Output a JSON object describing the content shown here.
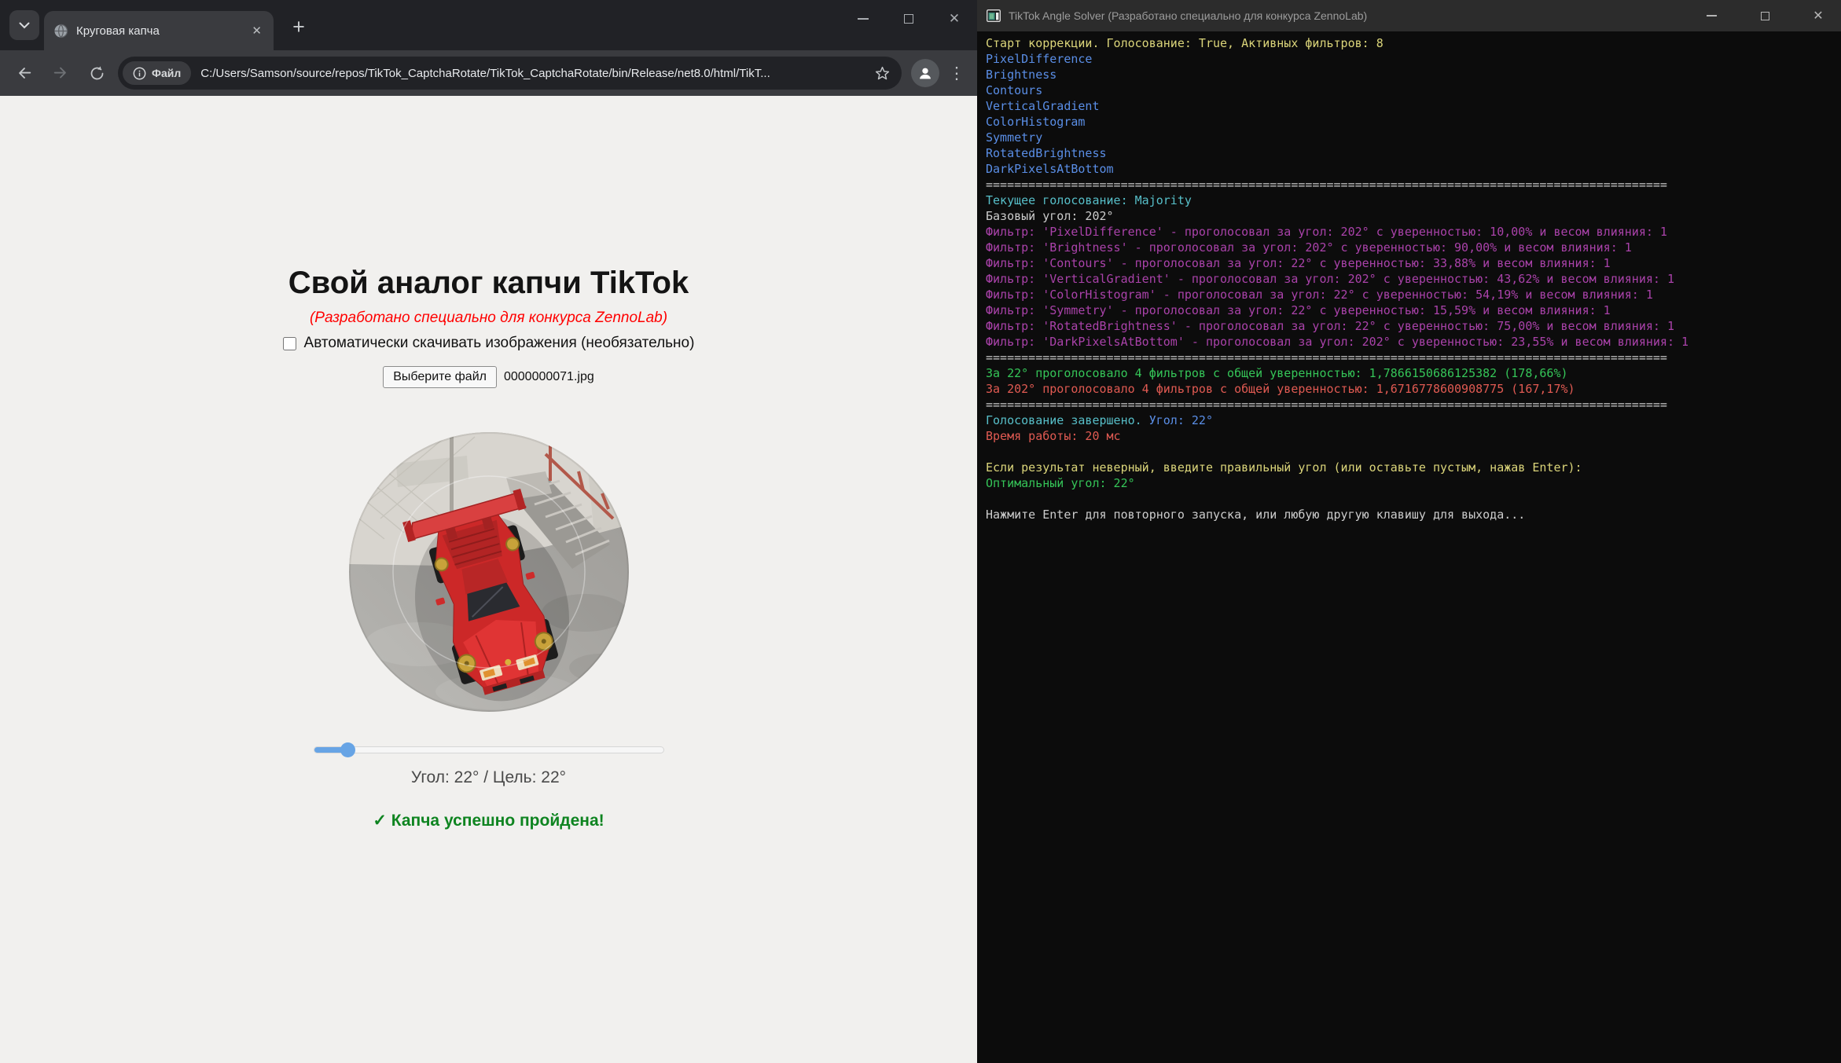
{
  "icons": {
    "close_glyph": "✕",
    "plus_glyph": "+",
    "menu_glyph": "⋮"
  },
  "browser": {
    "tab": {
      "title": "Круговая капча"
    },
    "nav": {
      "file_chip_label": "Файл",
      "url": "C:/Users/Samson/source/repos/TikTok_CaptchaRotate/TikTok_CaptchaRotate/bin/Release/net8.0/html/TikT..."
    },
    "page": {
      "title": "Свой аналог капчи TikTok",
      "subtitle": "(Разработано специально для конкурса ZennoLab)",
      "checkbox_label": "Автоматически скачивать изображения (необязательно)",
      "checkbox_checked": false,
      "file_button_label": "Выберите файл",
      "file_name": "0000000071.jpg",
      "slider_percent": 9.6,
      "angle_label": "Угол: 22° / Цель: 22°",
      "success_message": "✓ Капча успешно пройдена!"
    }
  },
  "console": {
    "title": "TikTok Angle Solver (Разработано специально для конкурса ZennoLab)",
    "colors": {
      "yellow": "#DBD57A",
      "blue": "#5A8EE6",
      "cyan": "#57BFC9",
      "magenta": "#AA42AA",
      "green": "#35C558",
      "red": "#E05A52",
      "white": "#CCCCCC"
    },
    "lines": [
      {
        "segments": [
          {
            "c": "yellow",
            "t": "Старт коррекции. Голосование: True, Активных фильтров: 8"
          }
        ]
      },
      {
        "segments": [
          {
            "c": "blue",
            "t": "PixelDifference"
          }
        ]
      },
      {
        "segments": [
          {
            "c": "blue",
            "t": "Brightness"
          }
        ]
      },
      {
        "segments": [
          {
            "c": "blue",
            "t": "Contours"
          }
        ]
      },
      {
        "segments": [
          {
            "c": "blue",
            "t": "VerticalGradient"
          }
        ]
      },
      {
        "segments": [
          {
            "c": "blue",
            "t": "ColorHistogram"
          }
        ]
      },
      {
        "segments": [
          {
            "c": "blue",
            "t": "Symmetry"
          }
        ]
      },
      {
        "segments": [
          {
            "c": "blue",
            "t": "RotatedBrightness"
          }
        ]
      },
      {
        "segments": [
          {
            "c": "blue",
            "t": "DarkPixelsAtBottom"
          }
        ]
      },
      {
        "segments": [
          {
            "c": "white",
            "t": "================================================================================================"
          }
        ]
      },
      {
        "segments": [
          {
            "c": "cyan",
            "t": "Текущее голосование: Majority"
          }
        ]
      },
      {
        "segments": [
          {
            "c": "white",
            "t": "Базовый угол: 202°"
          }
        ]
      },
      {
        "segments": [
          {
            "c": "magenta",
            "t": "Фильтр: 'PixelDifference' - проголосовал за угол: 202° с уверенностью: 10,00% и весом влияния: 1"
          }
        ]
      },
      {
        "segments": [
          {
            "c": "magenta",
            "t": "Фильтр: 'Brightness' - проголосовал за угол: 202° с уверенностью: 90,00% и весом влияния: 1"
          }
        ]
      },
      {
        "segments": [
          {
            "c": "magenta",
            "t": "Фильтр: 'Contours' - проголосовал за угол: 22° с уверенностью: 33,88% и весом влияния: 1"
          }
        ]
      },
      {
        "segments": [
          {
            "c": "magenta",
            "t": "Фильтр: 'VerticalGradient' - проголосовал за угол: 202° с уверенностью: 43,62% и весом влияния: 1"
          }
        ]
      },
      {
        "segments": [
          {
            "c": "magenta",
            "t": "Фильтр: 'ColorHistogram' - проголосовал за угол: 22° с уверенностью: 54,19% и весом влияния: 1"
          }
        ]
      },
      {
        "segments": [
          {
            "c": "magenta",
            "t": "Фильтр: 'Symmetry' - проголосовал за угол: 22° с уверенностью: 15,59% и весом влияния: 1"
          }
        ]
      },
      {
        "segments": [
          {
            "c": "magenta",
            "t": "Фильтр: 'RotatedBrightness' - проголосовал за угол: 22° с уверенностью: 75,00% и весом влияния: 1"
          }
        ]
      },
      {
        "segments": [
          {
            "c": "magenta",
            "t": "Фильтр: 'DarkPixelsAtBottom' - проголосовал за угол: 202° с уверенностью: 23,55% и весом влияния: 1"
          }
        ]
      },
      {
        "segments": [
          {
            "c": "white",
            "t": "================================================================================================"
          }
        ]
      },
      {
        "segments": [
          {
            "c": "green",
            "t": "За 22° проголосовало 4 фильтров с общей уверенностью: 1,7866150686125382 (178,66%)"
          }
        ]
      },
      {
        "segments": [
          {
            "c": "red",
            "t": "За 202° проголосовало 4 фильтров с общей уверенностью: 1,6716778600908775 (167,17%)"
          }
        ]
      },
      {
        "segments": [
          {
            "c": "white",
            "t": "================================================================================================"
          }
        ]
      },
      {
        "segments": [
          {
            "c": "cyan",
            "t": "Голосование завершено. "
          },
          {
            "c": "blue",
            "t": "Угол: 22°"
          }
        ]
      },
      {
        "segments": [
          {
            "c": "red",
            "t": "Время работы: 20 мс"
          }
        ]
      },
      {
        "segments": []
      },
      {
        "segments": [
          {
            "c": "yellow",
            "t": "Если результат неверный, введите правильный угол (или оставьте пустым, нажав Enter):"
          }
        ]
      },
      {
        "segments": [
          {
            "c": "green",
            "t": "Оптимальный угол: 22°"
          }
        ]
      },
      {
        "segments": []
      },
      {
        "segments": [
          {
            "c": "white",
            "t": "Нажмите Enter для повторного запуска, или любую другую клавишу для выхода..."
          }
        ]
      }
    ]
  }
}
